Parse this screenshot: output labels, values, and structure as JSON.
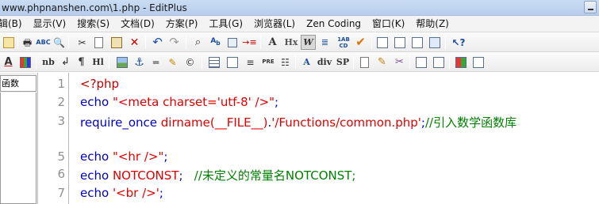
{
  "window": {
    "title": "www.phpnanshen.com\\1.php - EditPlus"
  },
  "menu": [
    {
      "label": "辑(B)"
    },
    {
      "label": "显示(V)"
    },
    {
      "label": "搜索(S)"
    },
    {
      "label": "文档(D)"
    },
    {
      "label": "方案(P)"
    },
    {
      "label": "工具(G)"
    },
    {
      "label": "浏览器(L)"
    },
    {
      "label": "Zen Coding"
    },
    {
      "label": "窗口(K)"
    },
    {
      "label": "帮助(Z)"
    }
  ],
  "toolbar_text": {
    "hx": "Hx",
    "w": "W",
    "abcd": "1AB\nCD",
    "nb": "nb",
    "pilcrow": "¶",
    "hl": "Hl",
    "pre": "PRE",
    "div": "div",
    "sp": "SP",
    "aa": "A",
    "a": "A"
  },
  "left_panel": {
    "tab_label": "函数"
  },
  "editor": {
    "line_numbers": [
      "1",
      "2",
      "3",
      "5",
      "6",
      "7"
    ],
    "lines": [
      [
        {
          "t": "<?php",
          "c": "c-tag"
        }
      ],
      [
        {
          "t": "echo ",
          "c": "c-plain"
        },
        {
          "t": "\"<meta charset='utf-8' />\"",
          "c": "c-str"
        },
        {
          "t": ";",
          "c": "c-plain"
        }
      ],
      [
        {
          "t": "require_once ",
          "c": "c-plain"
        },
        {
          "t": "dirname(__FILE__)",
          "c": "c-func"
        },
        {
          "t": ".",
          "c": "c-plain"
        },
        {
          "t": "'/Functions/common.php'",
          "c": "c-str"
        },
        {
          "t": ";",
          "c": "c-plain"
        },
        {
          "t": "//引入数学函数库",
          "c": "c-comment"
        }
      ],
      [
        {
          "t": "echo ",
          "c": "c-plain"
        },
        {
          "t": "\"<hr />\"",
          "c": "c-str"
        },
        {
          "t": ";",
          "c": "c-plain"
        }
      ],
      [
        {
          "t": "echo ",
          "c": "c-plain"
        },
        {
          "t": "NOTCONST",
          "c": "c-const"
        },
        {
          "t": ";   ",
          "c": "c-plain"
        },
        {
          "t": "//未定义的常量名NOTCONST;",
          "c": "c-comment"
        }
      ],
      [
        {
          "t": "echo ",
          "c": "c-plain"
        },
        {
          "t": "'<br />'",
          "c": "c-str"
        },
        {
          "t": ";",
          "c": "c-plain"
        }
      ]
    ]
  }
}
